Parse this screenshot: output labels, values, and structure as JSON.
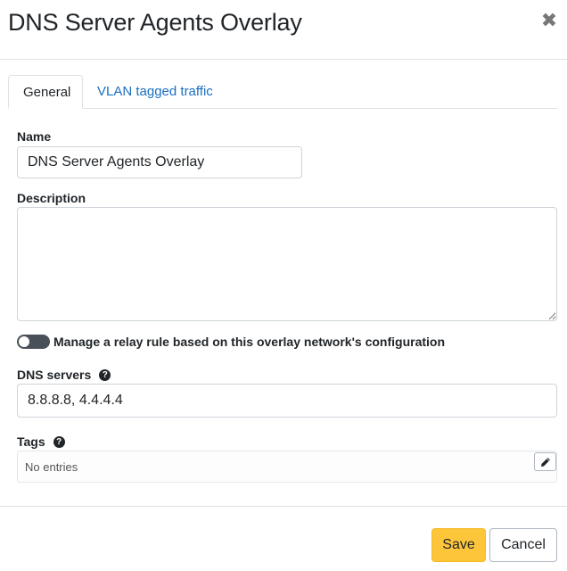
{
  "dialog": {
    "title": "DNS Server Agents Overlay",
    "close_icon": "close-icon",
    "close_glyph": "✖"
  },
  "tabs": [
    {
      "label": "General",
      "active": true
    },
    {
      "label": "VLAN tagged traffic",
      "active": false
    }
  ],
  "form": {
    "name": {
      "label": "Name",
      "value": "DNS Server Agents Overlay"
    },
    "description": {
      "label": "Description",
      "value": ""
    },
    "relay_toggle": {
      "label": "Manage a relay rule based on this overlay network's configuration",
      "enabled": false
    },
    "dns_servers": {
      "label": "DNS servers",
      "value": "8.8.8.8, 4.4.4.4",
      "help_icon": "question-circle-icon",
      "help_glyph": "?"
    },
    "tags": {
      "label": "Tags",
      "empty_text": "No entries",
      "help_icon": "question-circle-icon",
      "help_glyph": "?",
      "edit_icon": "pencil-icon"
    }
  },
  "footer": {
    "save_label": "Save",
    "cancel_label": "Cancel"
  },
  "colors": {
    "accent": "#fdc63a",
    "link": "#1a6fc0",
    "toggle_off": "#495057"
  }
}
